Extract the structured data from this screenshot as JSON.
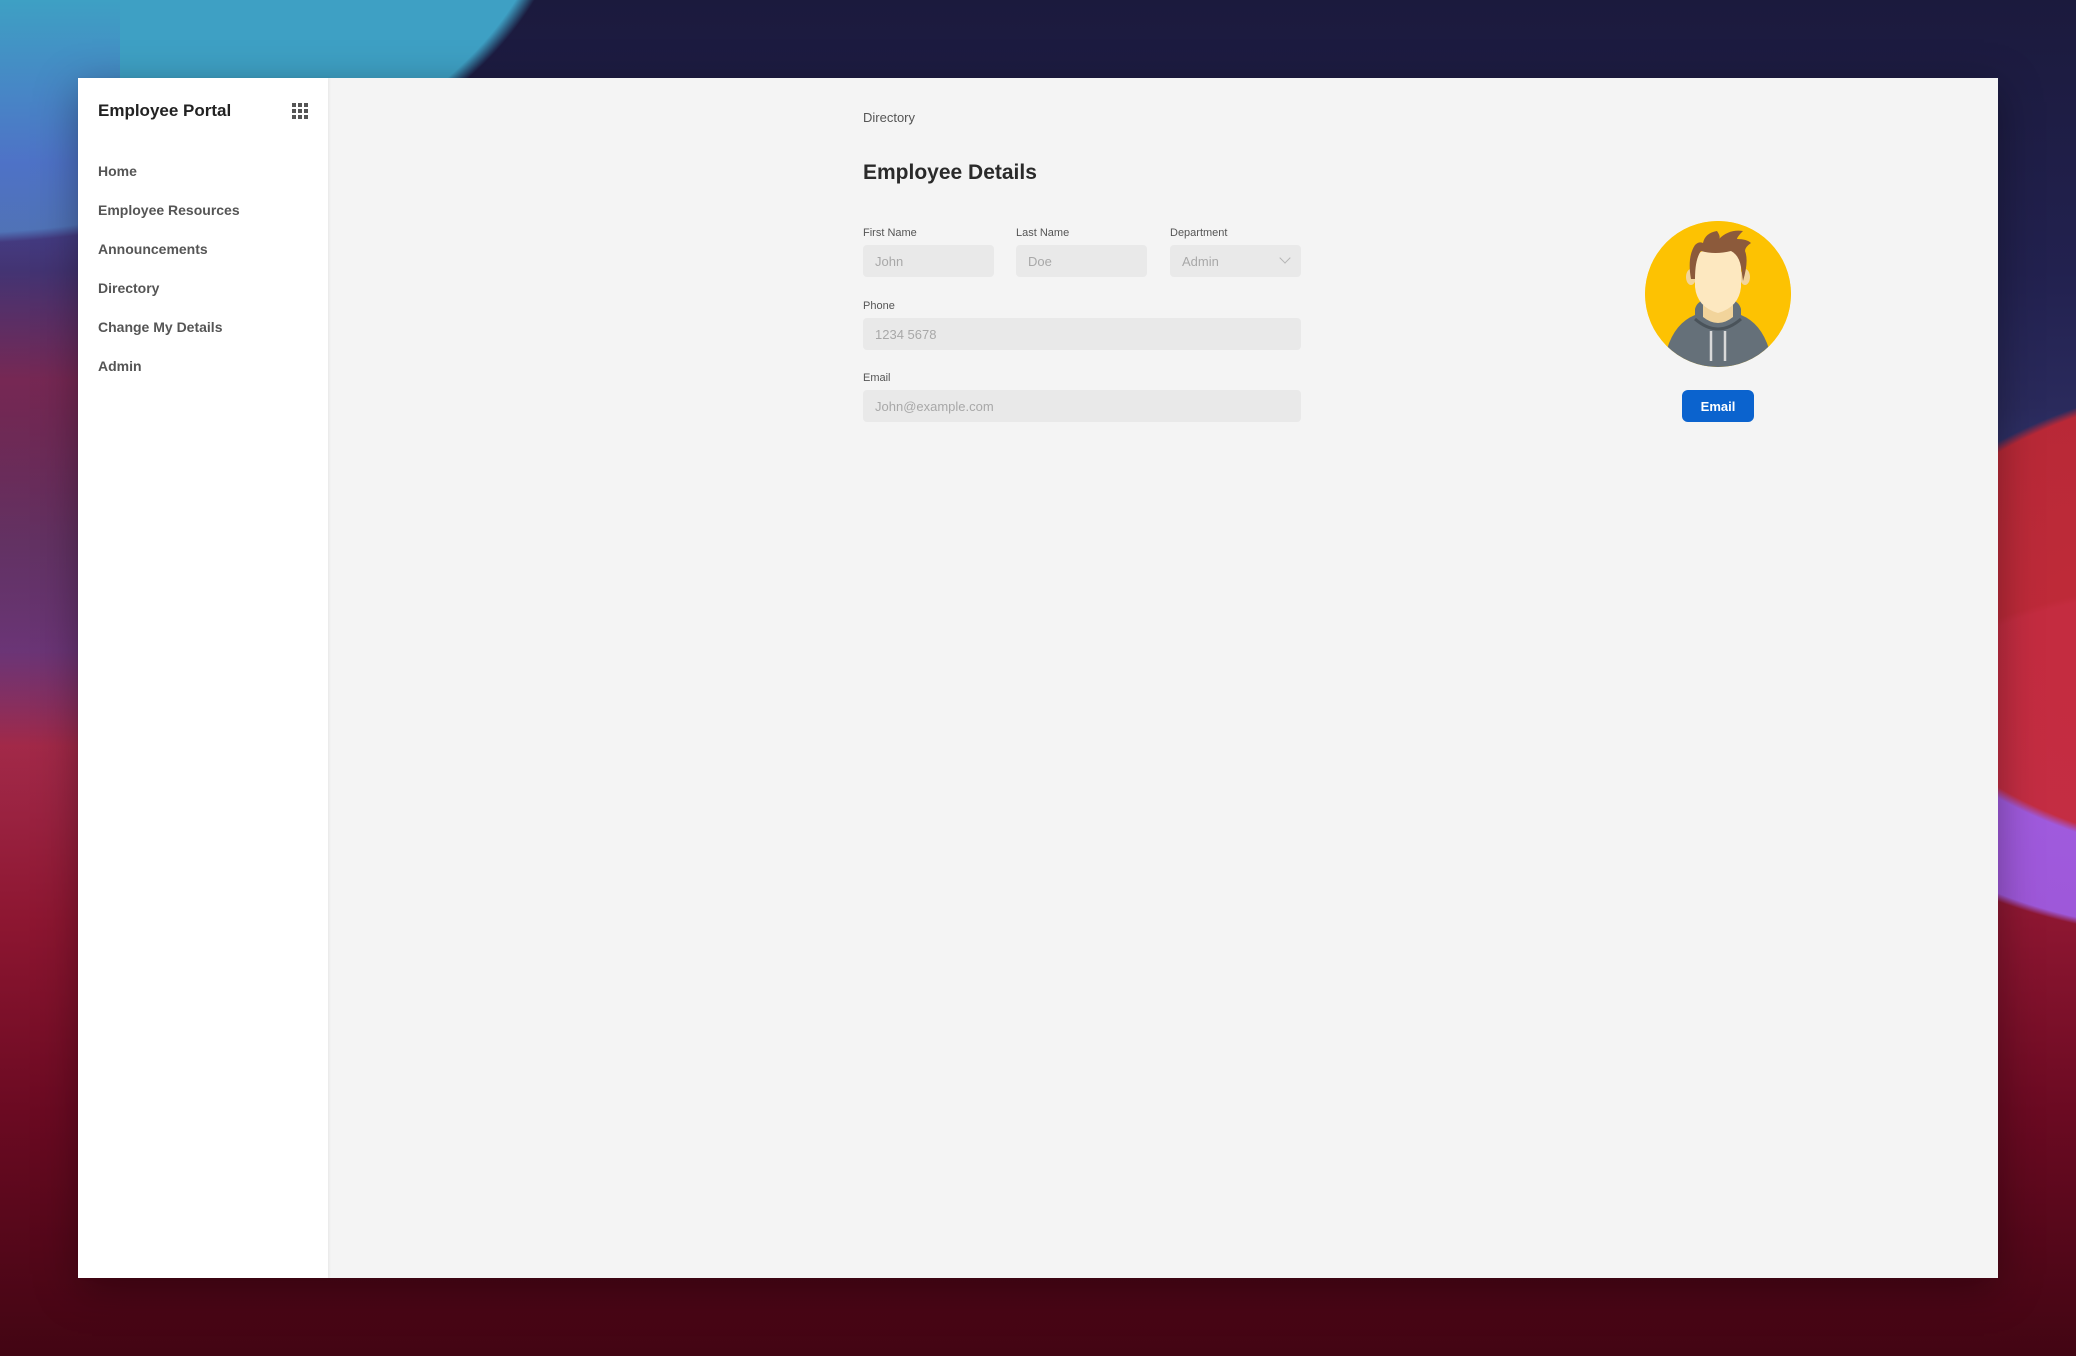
{
  "sidebar": {
    "brand": "Employee Portal",
    "apps_icon": "apps-grid-icon",
    "items": [
      {
        "label": "Home"
      },
      {
        "label": "Employee Resources"
      },
      {
        "label": "Announcements"
      },
      {
        "label": "Directory"
      },
      {
        "label": "Change My Details"
      },
      {
        "label": "Admin"
      }
    ]
  },
  "main": {
    "breadcrumb": "Directory",
    "title": "Employee Details",
    "form": {
      "first_name": {
        "label": "First Name",
        "placeholder": "John",
        "value": ""
      },
      "last_name": {
        "label": "Last Name",
        "placeholder": "Doe",
        "value": ""
      },
      "department": {
        "label": "Department",
        "selected": "Admin"
      },
      "phone": {
        "label": "Phone",
        "placeholder": "1234 5678",
        "value": ""
      },
      "email": {
        "label": "Email",
        "placeholder": "John@example.com",
        "value": ""
      }
    },
    "avatar": {
      "icon": "user-avatar-icon",
      "background": "#fdc202"
    },
    "email_button": {
      "label": "Email",
      "color": "#0b63ce"
    }
  }
}
